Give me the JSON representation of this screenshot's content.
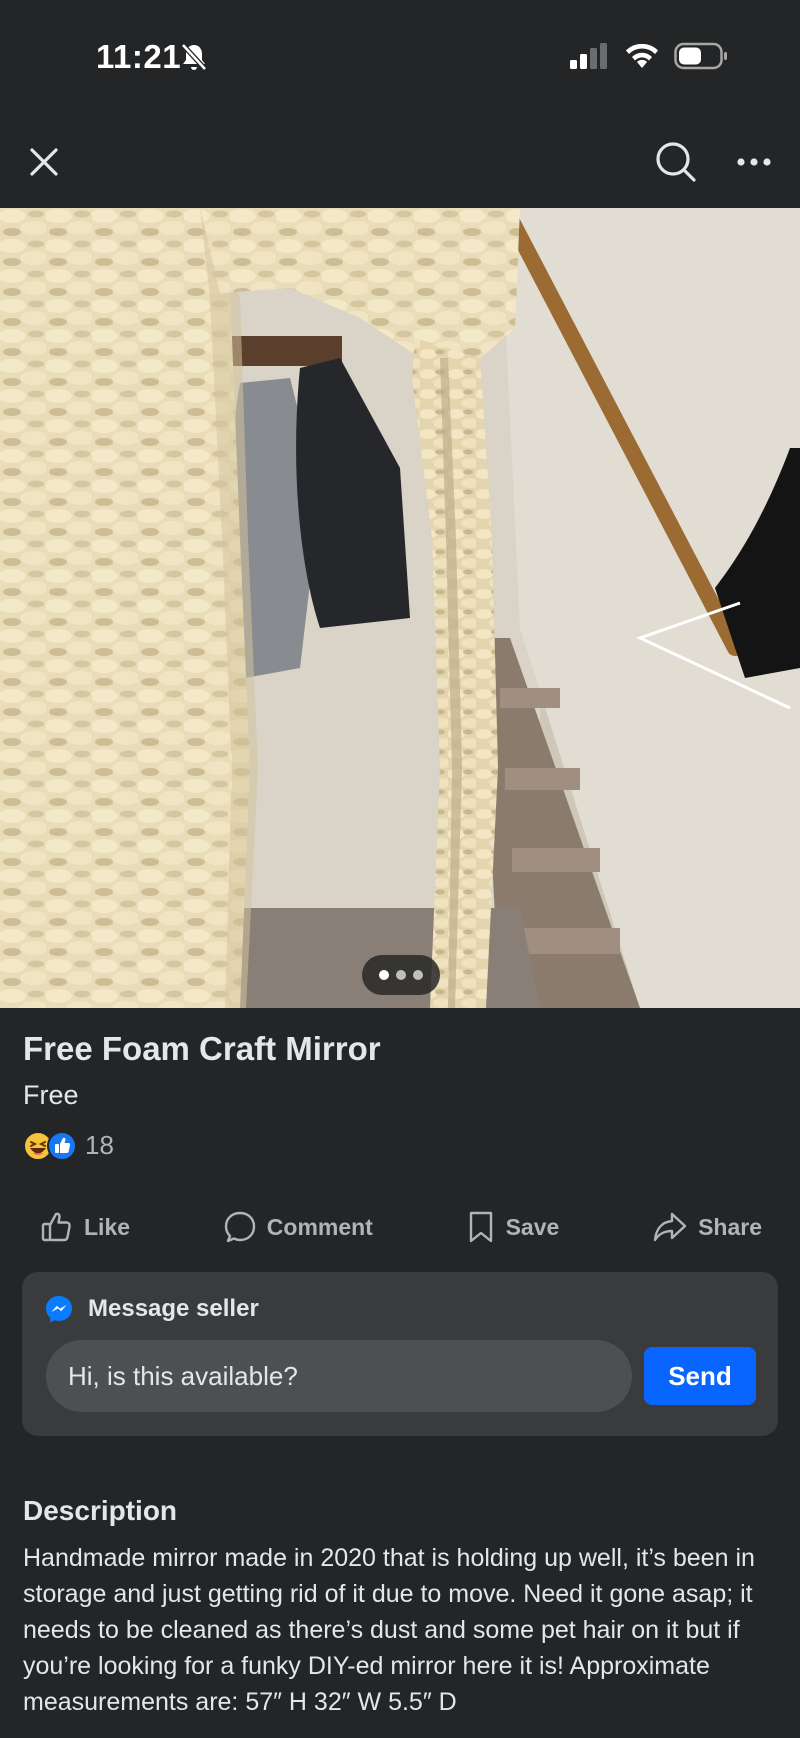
{
  "status_bar": {
    "time": "11:21",
    "icons": [
      "bell-slash-icon",
      "signal-icon",
      "wifi-icon",
      "battery-icon"
    ]
  },
  "nav": {
    "icons": [
      "close-icon",
      "search-icon",
      "more-icon"
    ]
  },
  "photo": {
    "subject": "foam-frame mirror",
    "pager_dots": 3,
    "active_dot": 1
  },
  "listing": {
    "title": "Free Foam Craft Mirror",
    "price": "Free",
    "reaction_count": "18",
    "reaction_icons": [
      "haha-icon",
      "like-icon"
    ]
  },
  "actions": {
    "like": "Like",
    "comment": "Comment",
    "save": "Save",
    "share": "Share"
  },
  "message": {
    "header": "Message seller",
    "input_value": "Hi, is this available?",
    "send": "Send"
  },
  "description": {
    "heading": "Description",
    "body": "Handmade mirror made in 2020 that is holding up well, it’s been in storage and just getting rid of it due to move. Need it gone asap; it needs to be cleaned as there’s dust and some pet hair on it but if you’re looking for a funky DIY-ed mirror here it is! Approximate measurements are: 57″ H 32″ W 5.5″ D"
  },
  "colors": {
    "background": "#242526",
    "card": "#3a3b3c",
    "accent": "#0866ff",
    "text": "#e4e6eb",
    "secondary_text": "#b0b3b8"
  }
}
